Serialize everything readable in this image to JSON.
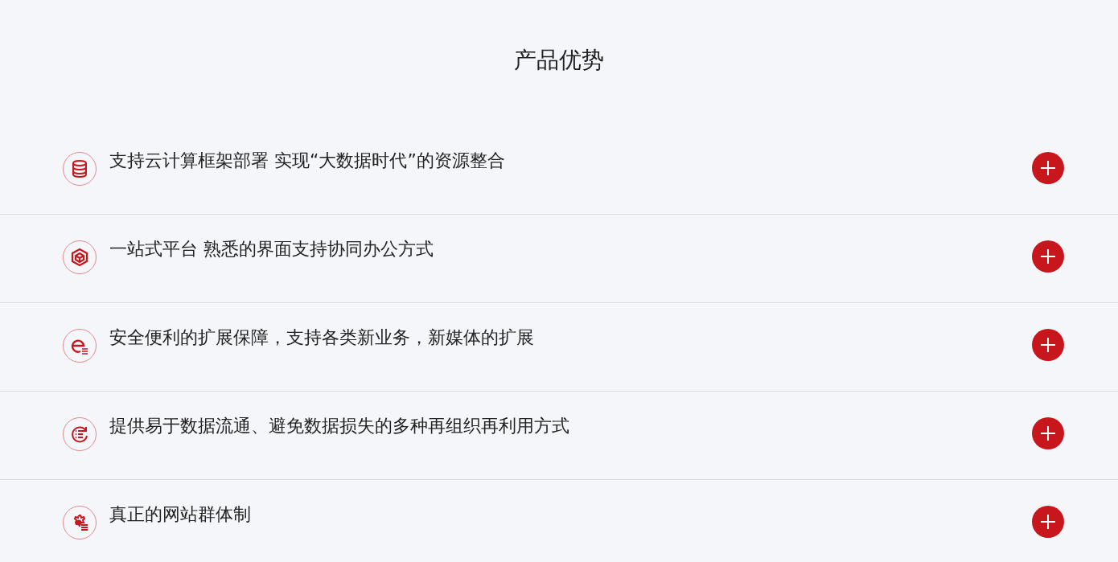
{
  "title": "产品优势",
  "items": [
    {
      "text": "支持云计算框架部署 实现“大数据时代”的资源整合",
      "expanded": false
    },
    {
      "text": "一站式平台 熟悉的界面支持协同办公方式",
      "expanded": false
    },
    {
      "text": "安全便利的扩展保障，支持各类新业务，新媒体的扩展",
      "expanded": false
    },
    {
      "text": "提供易于数据流通、避免数据损失的多种再组织再利用方式",
      "expanded": false
    },
    {
      "text": "真正的网站群体制",
      "expanded": false
    }
  ]
}
